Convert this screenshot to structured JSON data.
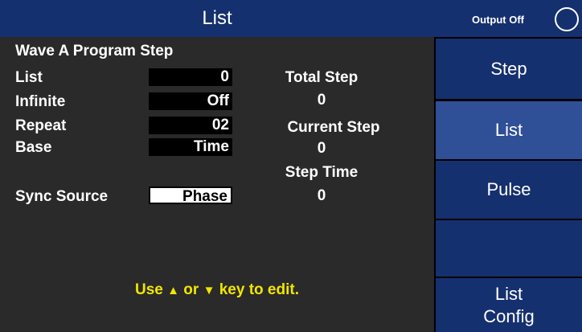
{
  "header": {
    "title": "List",
    "output_status": "Output Off"
  },
  "panel": {
    "heading": "Wave  A  Program Step",
    "list": {
      "label": "List",
      "value": "0"
    },
    "infinite": {
      "label": "Infinite",
      "value": "Off"
    },
    "repeat": {
      "label": "Repeat",
      "value": "02"
    },
    "base": {
      "label": "Base",
      "value": "Time"
    },
    "sync_source": {
      "label": "Sync Source",
      "value": "Phase"
    },
    "total_step": {
      "label": "Total Step",
      "value": "0"
    },
    "current_step": {
      "label": "Current Step",
      "value": "0"
    },
    "step_time": {
      "label": "Step Time",
      "value": "0"
    }
  },
  "hint": {
    "use": "Use",
    "or": "or",
    "rest": "key to edit.",
    "up_icon": "up-arrow-icon",
    "down_icon": "down-arrow-icon"
  },
  "softkeys": [
    {
      "label": "Step"
    },
    {
      "label": "List",
      "active": true
    },
    {
      "label": "Pulse"
    },
    {
      "label": ""
    },
    {
      "label": "List\nConfig"
    }
  ],
  "colors": {
    "header_blue": "#15306e",
    "softkey_active": "#2f4f96",
    "hint_yellow": "#f2e500"
  }
}
